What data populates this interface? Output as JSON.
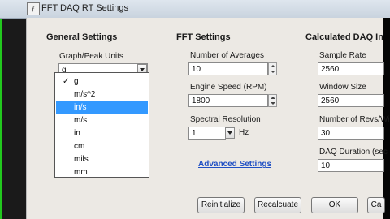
{
  "window": {
    "title": "FFT DAQ RT Settings",
    "icon": "daq-app-icon"
  },
  "general": {
    "heading": "General Settings",
    "units_label": "Graph/Peak Units",
    "units_value": "g",
    "units_options": [
      {
        "label": "g",
        "checked": true
      },
      {
        "label": "m/s^2"
      },
      {
        "label": "in/s",
        "highlighted": true
      },
      {
        "label": "m/s"
      },
      {
        "label": "in"
      },
      {
        "label": "cm"
      },
      {
        "label": "mils"
      },
      {
        "label": "mm"
      }
    ]
  },
  "fft": {
    "heading": "FFT Settings",
    "averages_label": "Number of Averages",
    "averages_value": "10",
    "speed_label": "Engine Speed (RPM)",
    "speed_value": "1800",
    "resolution_label": "Spectral Resolution",
    "resolution_value": "1",
    "resolution_unit": "Hz",
    "advanced_link": "Advanced Settings"
  },
  "calc": {
    "heading": "Calculated DAQ In",
    "sample_rate_label": "Sample Rate",
    "sample_rate_value": "2560",
    "window_size_label": "Window Size",
    "window_size_value": "2560",
    "revs_label": "Number of Revs/Win",
    "revs_value": "30",
    "duration_label": "DAQ Duration (sec",
    "duration_value": "10"
  },
  "buttons": {
    "reinitialize": "Reinitialize",
    "recalculate": "Recalcuate",
    "ok": "OK",
    "cancel": "Ca"
  },
  "colors": {
    "accent_green": "#22c81e",
    "selection": "#3399ff",
    "link": "#1f4fc4"
  }
}
